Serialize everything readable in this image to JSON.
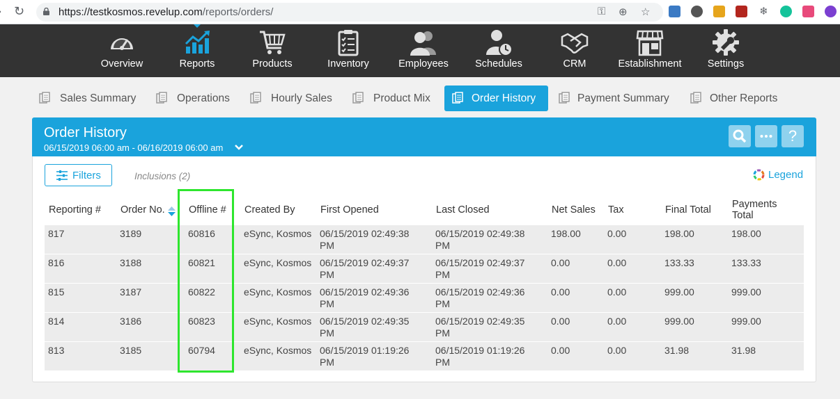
{
  "browser": {
    "url_host": "https://testkosmos.revelup.com",
    "url_path": "/reports/orders/"
  },
  "topnav": {
    "items": [
      {
        "label": "Overview",
        "icon": "gauge-icon"
      },
      {
        "label": "Reports",
        "icon": "bar-chart-icon",
        "active": true
      },
      {
        "label": "Products",
        "icon": "cart-icon"
      },
      {
        "label": "Inventory",
        "icon": "clipboard-icon"
      },
      {
        "label": "Employees",
        "icon": "people-icon"
      },
      {
        "label": "Schedules",
        "icon": "person-clock-icon"
      },
      {
        "label": "CRM",
        "icon": "handshake-icon"
      },
      {
        "label": "Establishment",
        "icon": "storefront-icon"
      },
      {
        "label": "Settings",
        "icon": "gear-icon"
      }
    ]
  },
  "tabs": [
    {
      "label": "Sales Summary"
    },
    {
      "label": "Operations"
    },
    {
      "label": "Hourly Sales"
    },
    {
      "label": "Product Mix"
    },
    {
      "label": "Order History",
      "active": true
    },
    {
      "label": "Payment Summary"
    },
    {
      "label": "Other Reports"
    }
  ],
  "report": {
    "title": "Order History",
    "date_range": "06/15/2019 06:00 am - 06/16/2019 06:00 am",
    "filters_label": "Filters",
    "inclusions_label": "Inclusions (2)",
    "legend_label": "Legend",
    "help_label": "?"
  },
  "table": {
    "headers": {
      "reporting": "Reporting #",
      "order_no": "Order No.",
      "offline": "Offline #",
      "created_by": "Created By",
      "first_opened": "First Opened",
      "last_closed": "Last Closed",
      "net_sales": "Net Sales",
      "tax": "Tax",
      "final_total": "Final Total",
      "payments_total": "Payments Total"
    },
    "rows": [
      {
        "reporting": "817",
        "order_no": "3189",
        "offline": "60816",
        "created_by": "eSync, Kosmos",
        "first_opened": "06/15/2019 02:49:38 PM",
        "last_closed": "06/15/2019 02:49:38 PM",
        "net_sales": "198.00",
        "tax": "0.00",
        "final_total": "198.00",
        "payments_total": "198.00"
      },
      {
        "reporting": "816",
        "order_no": "3188",
        "offline": "60821",
        "created_by": "eSync, Kosmos",
        "first_opened": "06/15/2019 02:49:37 PM",
        "last_closed": "06/15/2019 02:49:37 PM",
        "net_sales": "0.00",
        "tax": "0.00",
        "final_total": "133.33",
        "payments_total": "133.33"
      },
      {
        "reporting": "815",
        "order_no": "3187",
        "offline": "60822",
        "created_by": "eSync, Kosmos",
        "first_opened": "06/15/2019 02:49:36 PM",
        "last_closed": "06/15/2019 02:49:36 PM",
        "net_sales": "0.00",
        "tax": "0.00",
        "final_total": "999.00",
        "payments_total": "999.00"
      },
      {
        "reporting": "814",
        "order_no": "3186",
        "offline": "60823",
        "created_by": "eSync, Kosmos",
        "first_opened": "06/15/2019 02:49:35 PM",
        "last_closed": "06/15/2019 02:49:35 PM",
        "net_sales": "0.00",
        "tax": "0.00",
        "final_total": "999.00",
        "payments_total": "999.00"
      },
      {
        "reporting": "813",
        "order_no": "3185",
        "offline": "60794",
        "created_by": "eSync, Kosmos",
        "first_opened": "06/15/2019 01:19:26 PM",
        "last_closed": "06/15/2019 01:19:26 PM",
        "net_sales": "0.00",
        "tax": "0.00",
        "final_total": "31.98",
        "payments_total": "31.98"
      }
    ]
  },
  "colors": {
    "accent": "#1aa3dc",
    "nav_bg": "#333333",
    "highlight_box": "#2ee62e"
  }
}
